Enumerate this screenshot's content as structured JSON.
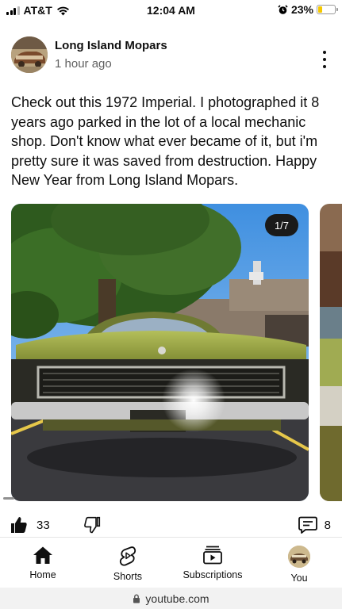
{
  "status_bar": {
    "carrier": "AT&T",
    "time": "12:04 AM",
    "battery": "23%",
    "battery_level": 0.23,
    "icons": [
      "signal-icon",
      "wifi-icon",
      "alarm-icon",
      "battery-icon"
    ]
  },
  "post": {
    "channel_name": "Long Island Mopars",
    "time_ago": "1 hour ago",
    "text": "Check out this 1972 Imperial. I photographed it 8 years ago parked in the lot of a local mechanic shop. Don't know what ever became of it, but i'm pretty sure it was saved from destruction. Happy New Year from Long Island Mopars.",
    "image_counter": "1/7",
    "likes": "33",
    "comments": "8"
  },
  "bottom_nav": {
    "items": [
      {
        "label": "Home",
        "icon": "home-icon"
      },
      {
        "label": "Shorts",
        "icon": "shorts-icon"
      },
      {
        "label": "Subscriptions",
        "icon": "subscriptions-icon"
      },
      {
        "label": "You",
        "icon": "avatar"
      }
    ]
  },
  "browser": {
    "url": "youtube.com"
  },
  "colors": {
    "car_body": "#a3b04a",
    "sky": "#5aa2e8",
    "counter_bg": "#1a1a1a",
    "battery": "#f5c800"
  }
}
